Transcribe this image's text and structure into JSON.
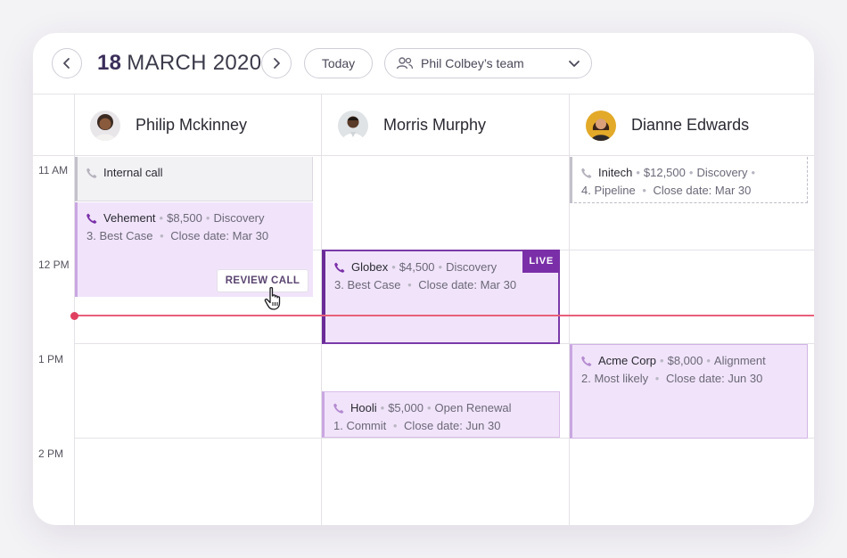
{
  "toolbar": {
    "date_day": "18",
    "date_rest": "MARCH 2020",
    "today_label": "Today",
    "team_label": "Phil Colbey’s team"
  },
  "people": [
    {
      "name": "Philip Mckinney"
    },
    {
      "name": "Morris Murphy"
    },
    {
      "name": "Dianne Edwards"
    }
  ],
  "times": [
    "11 AM",
    "12 PM",
    "1 PM",
    "2 PM"
  ],
  "events": {
    "internal": {
      "title": "Internal call"
    },
    "vehement": {
      "company": "Vehement",
      "amount": "$8,500",
      "stage": "Discovery",
      "forecast": "3. Best Case",
      "close": "Close date: Mar 30",
      "action": "REVIEW CALL"
    },
    "globex": {
      "company": "Globex",
      "amount": "$4,500",
      "stage": "Discovery",
      "forecast": "3. Best Case",
      "close": "Close date: Mar 30",
      "badge": "LIVE"
    },
    "hooli": {
      "company": "Hooli",
      "amount": "$5,000",
      "stage": "Open Renewal",
      "forecast": "1. Commit",
      "close": "Close date: Jun 30"
    },
    "initech": {
      "company": "Initech",
      "amount": "$12,500",
      "stage": "Discovery",
      "forecast": "4. Pipeline",
      "close": "Close date: Mar 30"
    },
    "acme": {
      "company": "Acme Corp",
      "amount": "$8,000",
      "stage": "Alignment",
      "forecast": "2. Most likely",
      "close": "Close date: Jun 30"
    }
  },
  "colors": {
    "accent": "#7a2fa8",
    "now_line": "#e8607a",
    "event_bg": "#f1e4fa"
  }
}
